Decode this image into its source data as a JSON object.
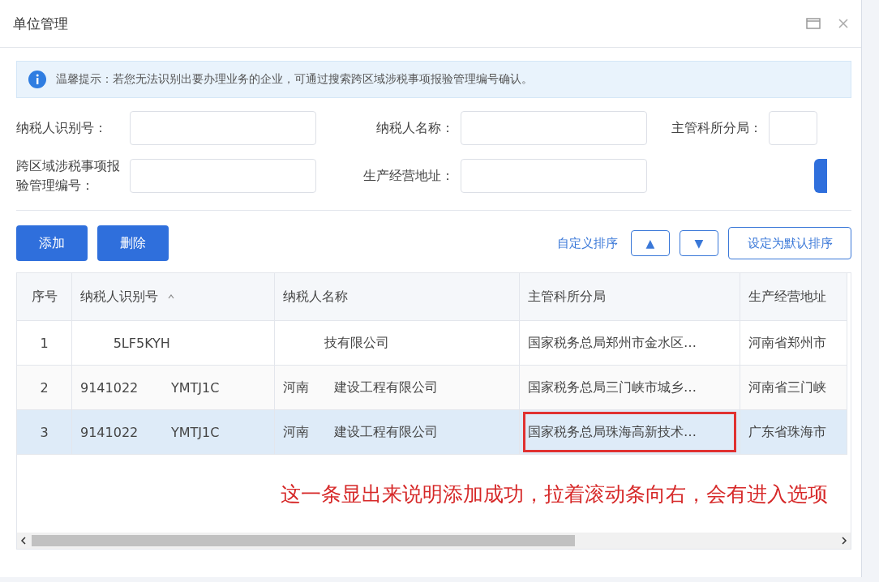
{
  "window": {
    "title": "单位管理"
  },
  "notice": "温馨提示：若您无法识别出要办理业务的企业，可通过搜索跨区域涉税事项报验管理编号确认。",
  "filters": [
    {
      "label": "纳税人识别号："
    },
    {
      "label": "纳税人名称："
    },
    {
      "label": "主管科所分局："
    },
    {
      "label": "跨区域涉税事项报验管理编号："
    },
    {
      "label": "生产经营地址："
    }
  ],
  "actions": [
    {
      "label": "添加"
    },
    {
      "label": "删除"
    }
  ],
  "sorting": {
    "label": "自定义排序",
    "up": "▲",
    "down": "▼",
    "default": "设定为默认排序"
  },
  "table": {
    "columns": [
      {
        "label": "序号",
        "sorted": false
      },
      {
        "label": "纳税人识别号",
        "sorted": true
      },
      {
        "label": "纳税人名称",
        "sorted": false
      },
      {
        "label": "主管科所分局",
        "sorted": false
      },
      {
        "label": "生产经营地址",
        "sorted": false
      }
    ],
    "rows": [
      {
        "selected": false,
        "cells": [
          "1",
          "        5LF5KYH",
          "          技有限公司",
          "国家税务总局郑州市金水区…",
          "河南省郑州市"
        ],
        "highlighted": false
      },
      {
        "selected": false,
        "cells": [
          "2",
          "9141022        YMTJ1C",
          "河南      建设工程有限公司",
          "国家税务总局三门峡市城乡…",
          "河南省三门峡"
        ],
        "highlighted": false
      },
      {
        "selected": true,
        "cells": [
          "3",
          "9141022        YMTJ1C",
          "河南      建设工程有限公司",
          "国家税务总局珠海高新技术…",
          "广东省珠海市"
        ],
        "highlighted": true
      }
    ]
  },
  "annotation": "这一条显出来说明添加成功，拉着滚动条向右，会有进入选项"
}
